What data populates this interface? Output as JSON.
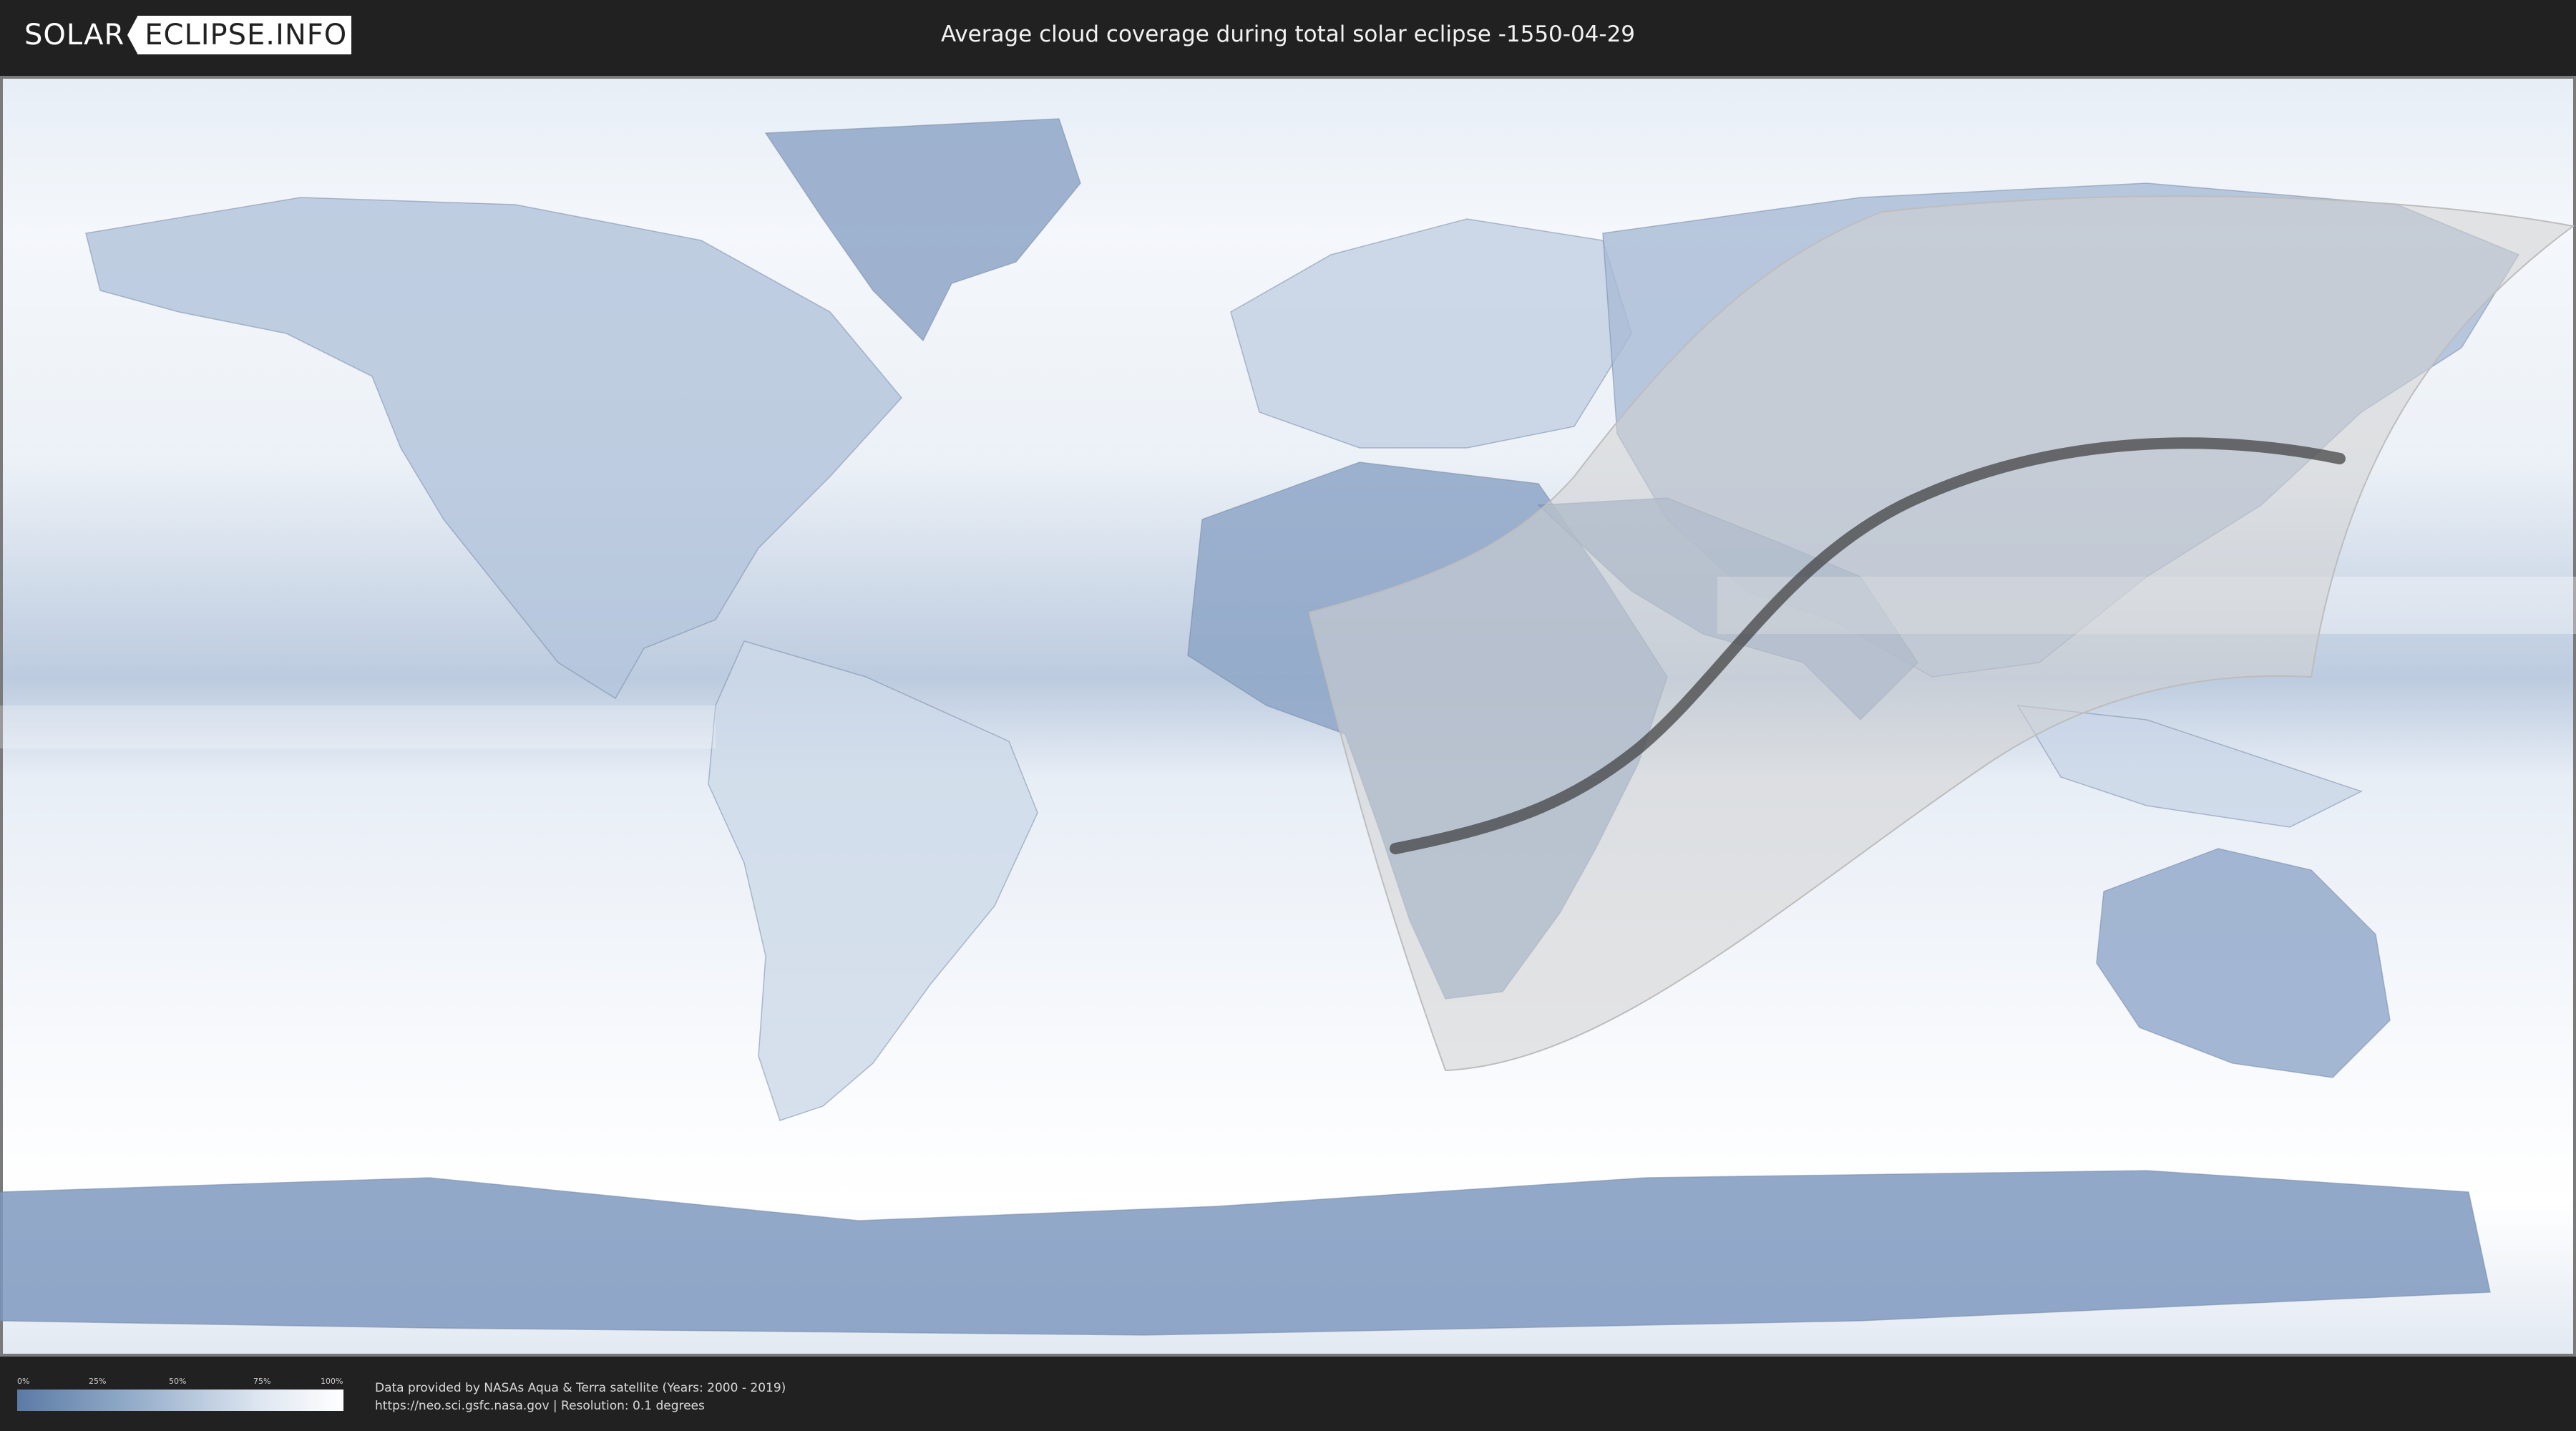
{
  "header": {
    "logo_left": "SOLAR",
    "logo_right": "ECLIPSE.INFO",
    "title": "Average cloud coverage during total solar eclipse -1550-04-29"
  },
  "map": {
    "background": "cloud-coverage-world-map",
    "colors": {
      "clear": "#5b7aa6",
      "mid": "#a8bcd6",
      "cloudy": "#ffffff",
      "visibility_zone": "#d2d2d2",
      "central_path": "#3a3a3a"
    }
  },
  "legend": {
    "ticks": [
      "0%",
      "25%",
      "50%",
      "75%",
      "100%"
    ]
  },
  "footer": {
    "source_line1": "Data provided by NASAs Aqua & Terra satellite (Years: 2000 - 2019)",
    "source_line2": "https://neo.sci.gsfc.nasa.gov | Resolution: 0.1 degrees"
  }
}
